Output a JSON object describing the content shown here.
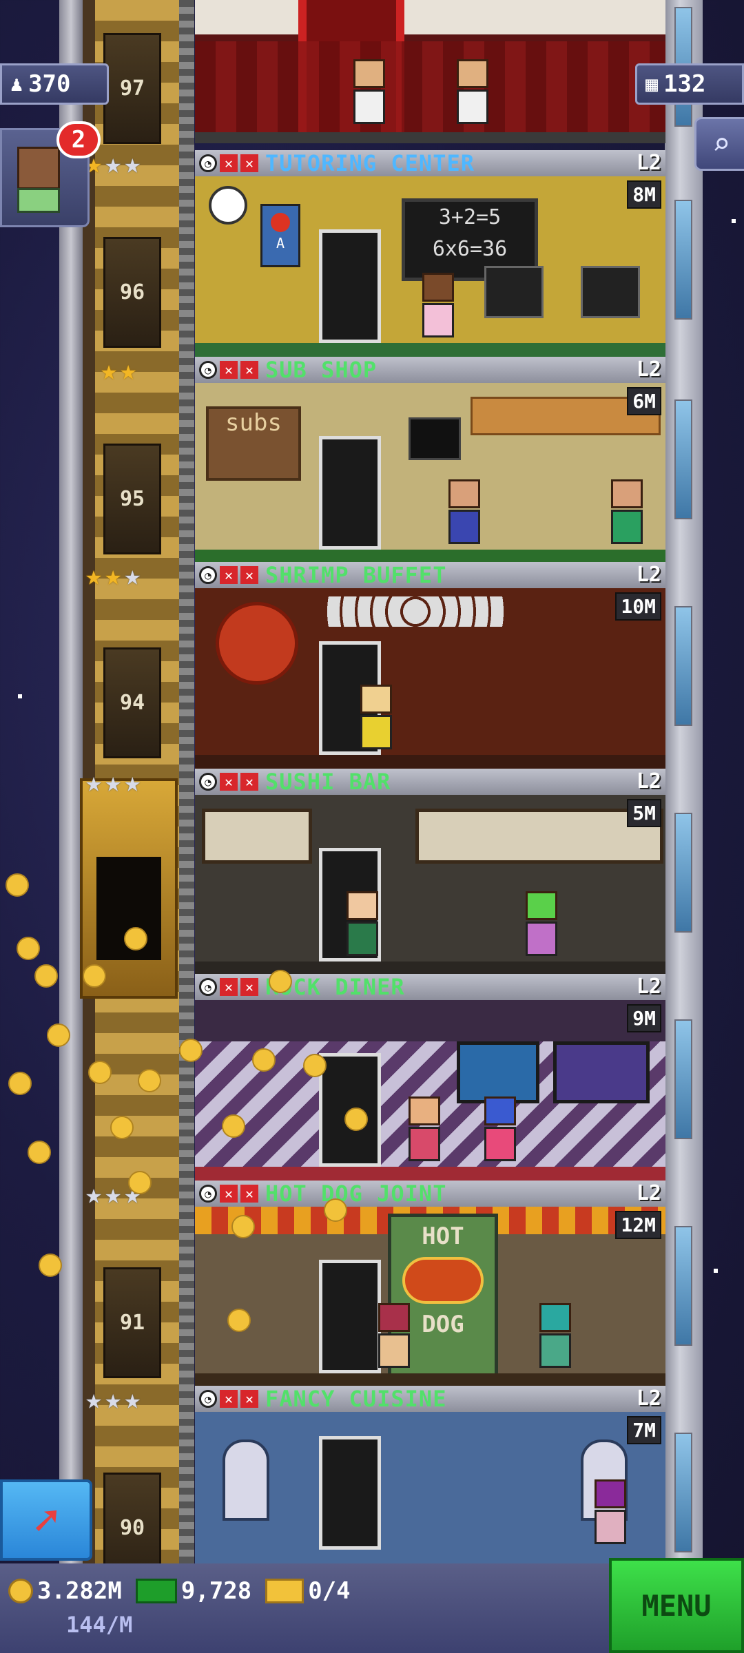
{
  "hud": {
    "population": "370",
    "floors": "132",
    "notification_count": "2"
  },
  "elevator": {
    "floor_numbers": [
      "97",
      "96",
      "95",
      "94",
      "91",
      "90"
    ]
  },
  "floors": [
    {
      "name": "TUTORING CENTER",
      "level": "L2",
      "time": "8M",
      "name_color": "#4fb7ff",
      "stars_gold": 1
    },
    {
      "name": "SUB SHOP",
      "level": "L2",
      "time": "6M",
      "name_color": "#52e06a",
      "stars_gold": 2
    },
    {
      "name": "SHRIMP BUFFET",
      "level": "L2",
      "time": "10M",
      "name_color": "#52e06a",
      "stars_gold": 2
    },
    {
      "name": "SUSHI BAR",
      "level": "L2",
      "time": "5M",
      "name_color": "#52e06a",
      "stars_gold": 0
    },
    {
      "name": "ROCK DINER",
      "level": "L2",
      "time": "9M",
      "name_color": "#52e06a",
      "stars_gold": 0
    },
    {
      "name": "HOT DOG JOINT",
      "level": "L2",
      "time": "12M",
      "name_color": "#52e06a",
      "stars_gold": 0
    },
    {
      "name": "FANCY CUISINE",
      "level": "L2",
      "time": "7M",
      "name_color": "#52e06a",
      "stars_gold": 0
    }
  ],
  "signage": {
    "blackboard_1": "3+2=5",
    "blackboard_2": "6x6=36",
    "subs_sign": "subs",
    "hotdog_top": "HOT",
    "hotdog_bottom": "DOG",
    "poster_letter": "A"
  },
  "bottom": {
    "coins": "3.282M",
    "rate": "144/M",
    "bux": "9,728",
    "gold": "0/4",
    "menu_label": "MENU"
  },
  "colors": {
    "gold_star": "#f2b624",
    "silver_star": "#d8dbe8",
    "menu_green": "#3ee04a"
  }
}
